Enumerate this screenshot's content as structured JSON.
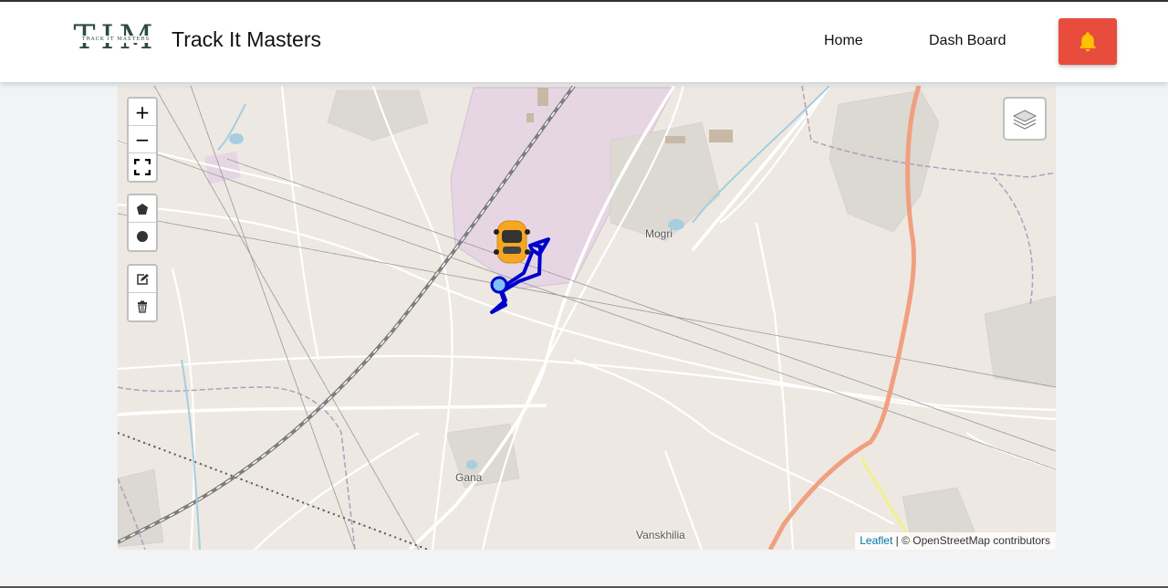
{
  "brand": {
    "logo_big": "TIM",
    "logo_small": "TRACK IT MASTERS",
    "title": "Track It Masters"
  },
  "nav": {
    "home": "Home",
    "dashboard": "Dash Board"
  },
  "map": {
    "zoom_in": "+",
    "zoom_out": "−",
    "places": {
      "mogri": "Mogri",
      "gana": "Gana",
      "vanskhilia": "Vanskhilia"
    },
    "attribution": {
      "leaflet": "Leaflet",
      "separator": " | ",
      "osm": "© OpenStreetMap contributors"
    }
  },
  "colors": {
    "alert_button": "#e74c3c",
    "route": "#0000cc",
    "vehicle": "#f5a623",
    "highway": "#f0a080"
  },
  "icons": {
    "alert": "bell-icon",
    "fullscreen": "fullscreen-icon",
    "polygon": "polygon-icon",
    "circle": "circle-icon",
    "edit": "edit-icon",
    "delete": "trash-icon",
    "layers": "layers-icon",
    "vehicle": "car-icon"
  }
}
